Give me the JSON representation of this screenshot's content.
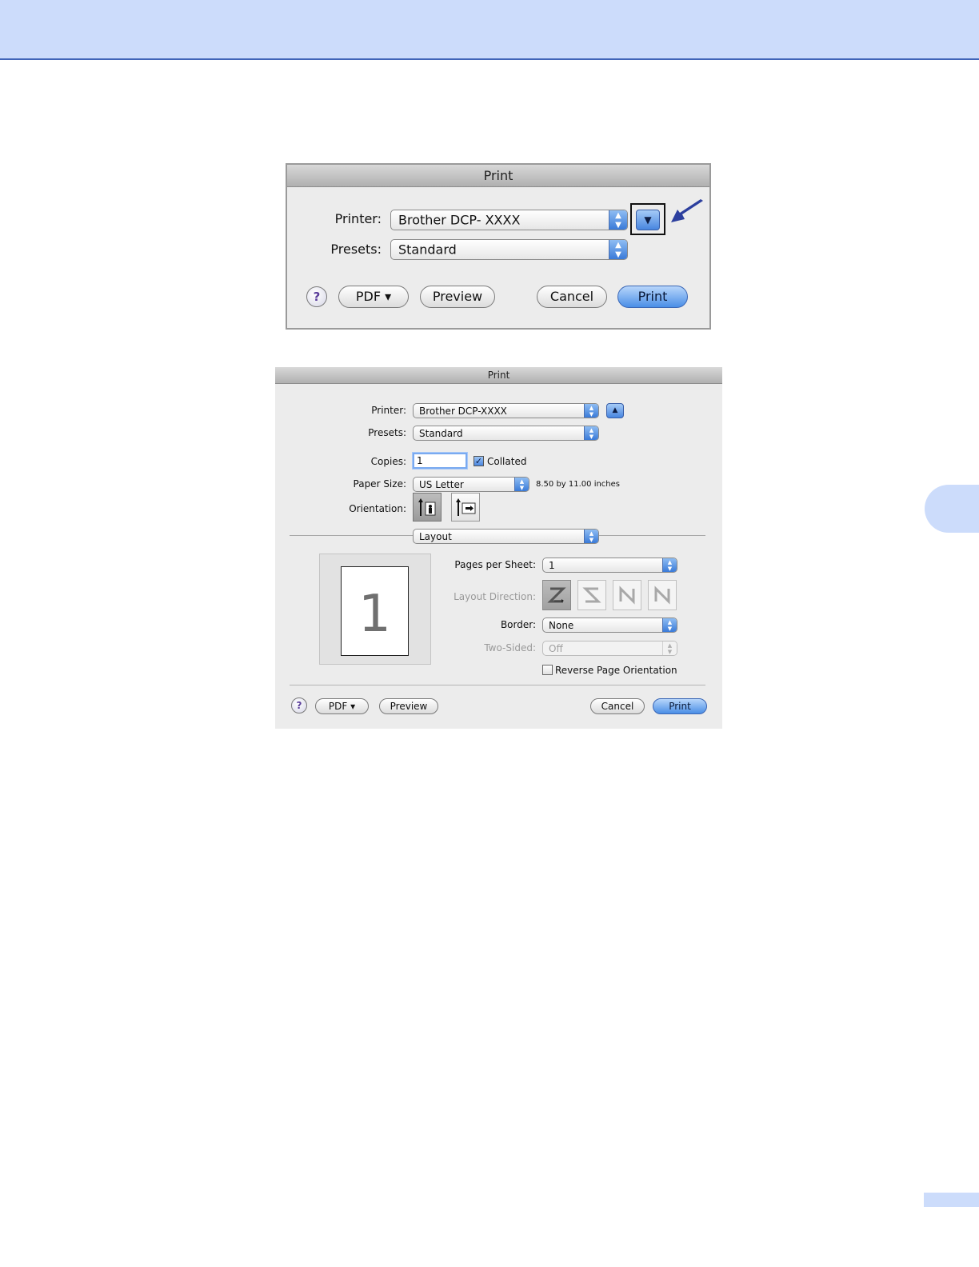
{
  "dialog1": {
    "title": "Print",
    "printer_label": "Printer:",
    "printer_value": "Brother DCP- XXXX",
    "presets_label": "Presets:",
    "presets_value": "Standard",
    "help_label": "?",
    "pdf_label": "PDF ▾",
    "preview_label": "Preview",
    "cancel_label": "Cancel",
    "print_label": "Print"
  },
  "dialog2": {
    "title": "Print",
    "printer_label": "Printer:",
    "printer_value": "Brother DCP-XXXX",
    "presets_label": "Presets:",
    "presets_value": "Standard",
    "copies_label": "Copies:",
    "copies_value": "1",
    "collated_label": "Collated",
    "collated_checked": true,
    "paper_size_label": "Paper Size:",
    "paper_size_value": "US Letter",
    "paper_size_note": "8.50 by 11.00 inches",
    "orientation_label": "Orientation:",
    "panel_value": "Layout",
    "preview_page_number": "1",
    "pages_per_sheet_label": "Pages per Sheet:",
    "pages_per_sheet_value": "1",
    "layout_direction_label": "Layout Direction:",
    "border_label": "Border:",
    "border_value": "None",
    "two_sided_label": "Two-Sided:",
    "two_sided_value": "Off",
    "reverse_label": "Reverse Page Orientation",
    "reverse_checked": false,
    "help_label": "?",
    "pdf_label": "PDF ▾",
    "preview_label": "Preview",
    "cancel_label": "Cancel",
    "print_label": "Print"
  },
  "colors": {
    "header_band": "#ccdcfb",
    "accent_blue": "#4a8ee6",
    "arrow_blue": "#2c3f9e"
  }
}
